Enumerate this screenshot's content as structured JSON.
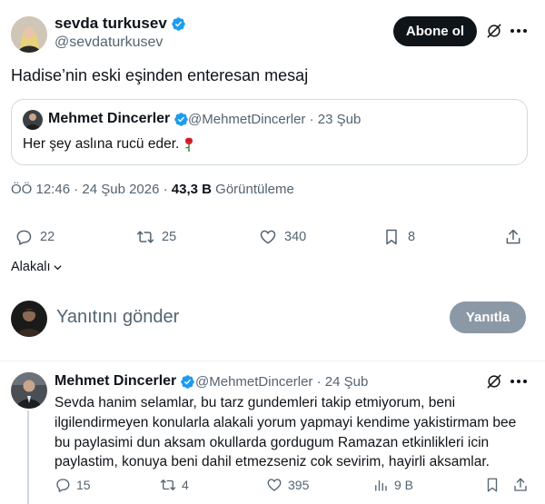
{
  "post": {
    "author_name": "sevda turkusev",
    "author_handle": "@sevdaturkusev",
    "follow_label": "Abone ol",
    "text": "Hadise’nin eski eşinden enteresan mesaj",
    "timestamp": "ÖÖ 12:46 · 24 Şub 2026 · ",
    "views_count": "43,3 B",
    "views_label": " Görüntüleme"
  },
  "quote": {
    "author_name": "Mehmet Dincerler",
    "meta": "@MehmetDincerler · 23 Şub",
    "text": "Her şey aslına rucü eder."
  },
  "actions": {
    "replies": "22",
    "reposts": "25",
    "likes": "340",
    "bookmarks": "8"
  },
  "sort_label": "Alakalı",
  "composer": {
    "placeholder": "Yanıtını gönder",
    "reply_button": "Yanıtla"
  },
  "reply": {
    "author_name": "Mehmet Dincerler",
    "meta": "@MehmetDincerler · 24 Şub",
    "text": "Sevda hanim selamlar, bu tarz gundemleri takip etmiyorum, beni ilgilendirmeyen konularla alakali yorum yapmayi kendime yakistirmam bee bu paylasimi dun aksam okullarda gordugum Ramazan etkinlikleri icin paylastim, konuya beni dahil etmezseniz cok sevirim, hayirli aksamlar.",
    "actions": {
      "replies": "15",
      "reposts": "4",
      "likes": "395",
      "views": "9 B"
    }
  },
  "colors": {
    "verified": "#1d9bf0",
    "text_primary": "#0f1419",
    "text_secondary": "#536471",
    "border": "#cfd9de",
    "follow_bg": "#0f1419",
    "reply_btn_bg": "#8b98a5"
  }
}
